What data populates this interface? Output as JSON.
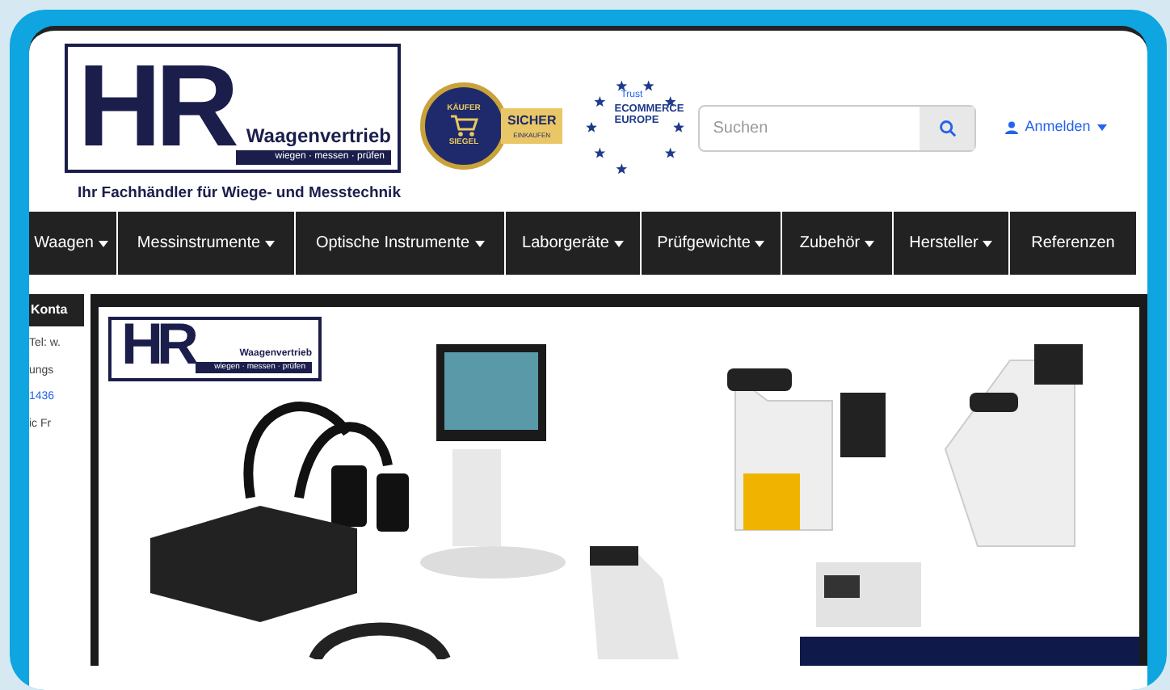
{
  "logo": {
    "letters": "HR",
    "name": "Waagenvertrieb",
    "motto": "wiegen · messen · prüfen",
    "tagline": "Ihr Fachhändler für Wiege- und Messtechnik"
  },
  "seals": [
    {
      "kind": "kaeufersiegel",
      "ring_top": "KÄUFER",
      "ring_bottom": "SIEGEL",
      "ribbon": "SICHER",
      "ribbon_sub": "EINKAUFEN"
    },
    {
      "kind": "trust",
      "check_text": "Trust",
      "lines": [
        "ECOMMERCE",
        "EUROPE"
      ]
    }
  ],
  "search": {
    "placeholder": "Suchen"
  },
  "account": {
    "label": "Anmelden"
  },
  "nav": [
    {
      "label": "Waagen",
      "dropdown": true
    },
    {
      "label": "Messinstrumente",
      "dropdown": true
    },
    {
      "label": "Optische Instrumente",
      "dropdown": true
    },
    {
      "label": "Laborgeräte",
      "dropdown": true
    },
    {
      "label": "Prüfgewichte",
      "dropdown": true
    },
    {
      "label": "Zubehör",
      "dropdown": true
    },
    {
      "label": "Hersteller",
      "dropdown": true
    },
    {
      "label": "Referenzen",
      "dropdown": false
    }
  ],
  "sidebar": {
    "heading": "Konta",
    "lines": [
      "Tel: w.",
      "ungs",
      "1436",
      "ic Fr"
    ]
  },
  "banner": {
    "logo": {
      "letters": "HR",
      "name": "Waagenvertrieb",
      "motto": "wiegen · messen · prüfen"
    }
  }
}
